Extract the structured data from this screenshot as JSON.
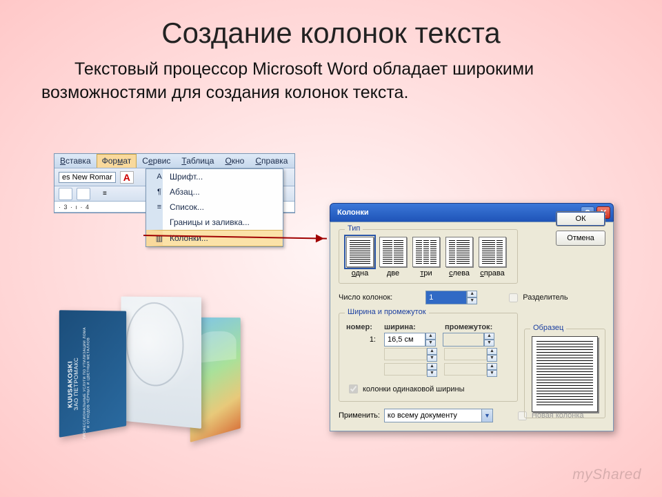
{
  "slide": {
    "title": "Создание колонок текста",
    "body": "Текстовый процессор Microsoft Word обладает широкими возможностями для создания колонок текста."
  },
  "word_menu": {
    "items": [
      "Вставка",
      "Формат",
      "Сервис",
      "Таблица",
      "Окно",
      "Справка"
    ],
    "active": "Формат",
    "font_combo": "es New Romar",
    "ruler": "· 3 · ı · 4",
    "drop": {
      "items": [
        "Шрифт...",
        "Абзац...",
        "Список...",
        "Границы и заливка...",
        "Колонки..."
      ],
      "selected": "Колонки..."
    }
  },
  "brochure": {
    "brand_line1": "KUUSAKOSKI",
    "brand_line2": "ЗАО ПЕТРОМАКС",
    "tagline": "ПРОФЕССИОНАЛЬНЫЕ УСЛУГИ ПО УТИЛИЗАЦИИ ЛОМА И ОТХОДОВ ЧЁРНЫХ И ЦВЕТНЫХ МЕТАЛЛОВ"
  },
  "dialog": {
    "title": "Колонки",
    "ok": "ОК",
    "cancel": "Отмена",
    "group_type": "Тип",
    "types": [
      {
        "label": "одна",
        "cols": [
          1
        ]
      },
      {
        "label": "две",
        "cols": [
          1,
          1
        ]
      },
      {
        "label": "три",
        "cols": [
          1,
          1,
          1
        ]
      },
      {
        "label": "слева",
        "cols": [
          1,
          2
        ]
      },
      {
        "label": "справа",
        "cols": [
          2,
          1
        ]
      }
    ],
    "selected_type": 0,
    "num_cols_label": "Число колонок:",
    "num_cols_value": "1",
    "separator_label": "Разделитель",
    "group_width": "Ширина и промежуток",
    "headers": {
      "num": "номер:",
      "width": "ширина:",
      "gap": "промежуток:"
    },
    "row_num": "1:",
    "row_width": "16,5 см",
    "equal_label": "колонки одинаковой ширины",
    "preview_label": "Образец",
    "apply_label": "Применить:",
    "apply_value": "ко всему документу",
    "new_col_label": "Новая колонка"
  },
  "watermark": "myShared"
}
